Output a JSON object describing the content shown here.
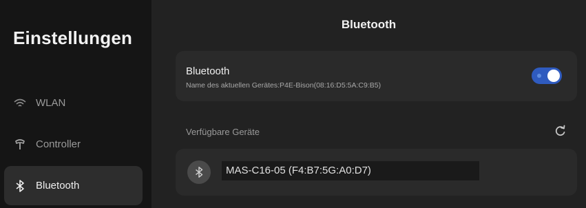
{
  "sidebar": {
    "title": "Einstellungen",
    "items": [
      {
        "label": "WLAN",
        "icon": "wifi-icon"
      },
      {
        "label": "Controller",
        "icon": "controller-icon"
      },
      {
        "label": "Bluetooth",
        "icon": "bluetooth-icon",
        "active": true
      }
    ]
  },
  "main": {
    "title": "Bluetooth",
    "bluetooth_card": {
      "label": "Bluetooth",
      "device_name_text": "Name des aktuellen Gerätes:P4E-Bison(08:16:D5:5A:C9:B5)",
      "toggle_on": true
    },
    "available_label": "Verfügbare Geräte",
    "refresh_icon": "refresh-icon",
    "devices": [
      {
        "name": "MAS-C16-05 (F4:B7:5G:A0:D7)",
        "icon": "bluetooth-icon"
      }
    ]
  },
  "colors": {
    "sidebar_bg": "#151515",
    "main_bg": "#222222",
    "card_bg": "#2a2a2a",
    "accent": "#2f5bbf"
  }
}
